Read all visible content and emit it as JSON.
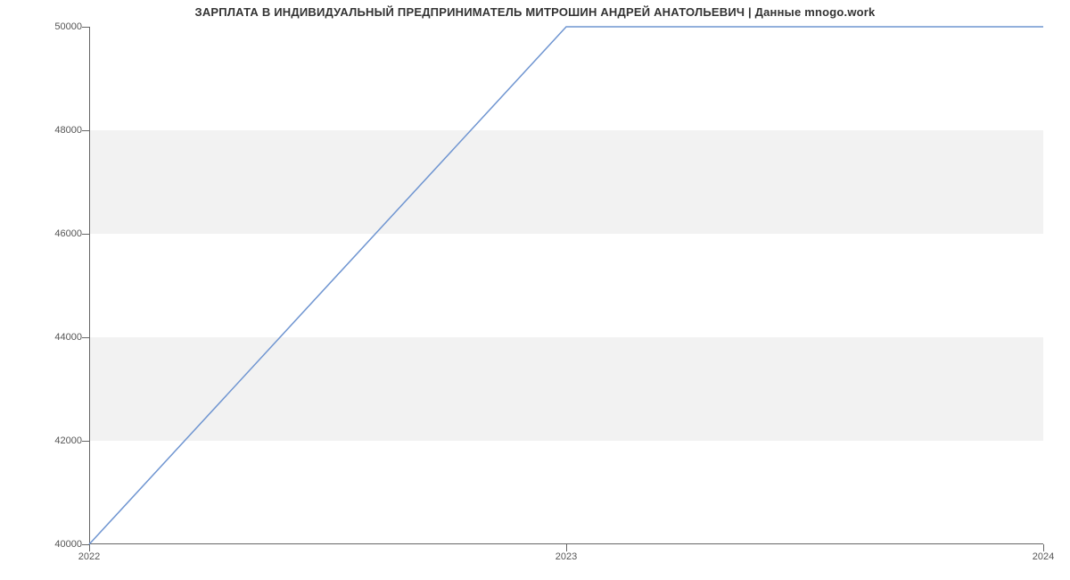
{
  "chart_data": {
    "type": "line",
    "title": "ЗАРПЛАТА В ИНДИВИДУАЛЬНЫЙ ПРЕДПРИНИМАТЕЛЬ МИТРОШИН АНДРЕЙ АНАТОЛЬЕВИЧ | Данные mnogo.work",
    "xlabel": "",
    "ylabel": "",
    "x": [
      2022,
      2023,
      2024
    ],
    "values": [
      40000,
      50000,
      50000
    ],
    "ylim": [
      40000,
      50000
    ],
    "xlim": [
      2022,
      2024
    ],
    "y_ticks": [
      40000,
      42000,
      44000,
      46000,
      48000,
      50000
    ],
    "x_ticks": [
      2022,
      2023,
      2024
    ],
    "line_color": "#6f95d1",
    "grid_bands": true
  }
}
